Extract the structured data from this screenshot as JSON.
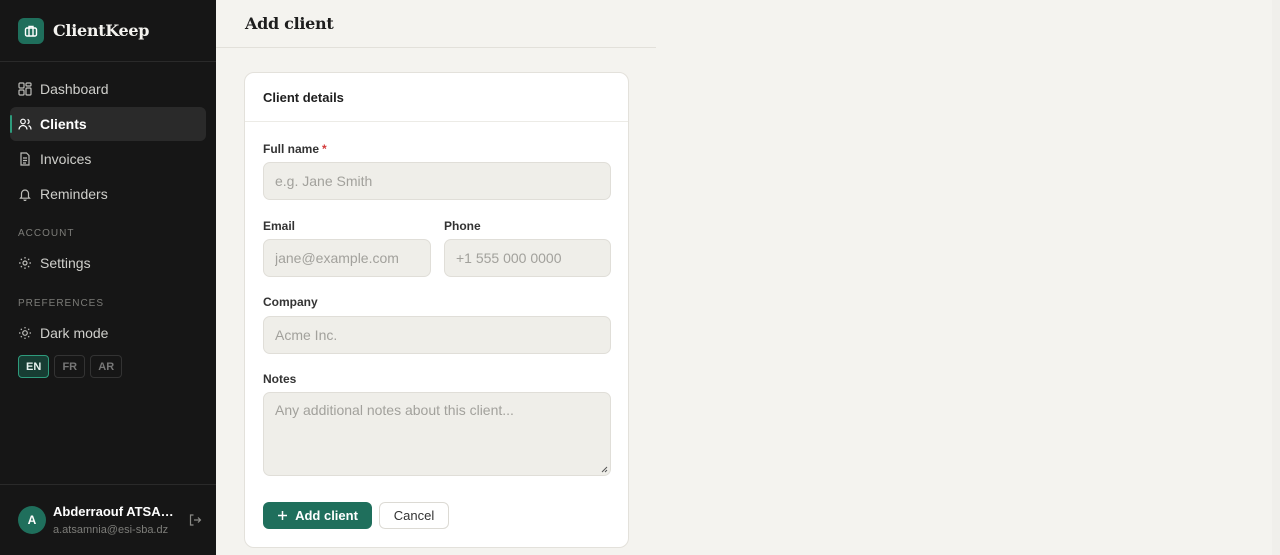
{
  "app": {
    "name": "ClientKeep"
  },
  "sidebar": {
    "nav": [
      {
        "label": "Dashboard",
        "icon": "grid-icon"
      },
      {
        "label": "Clients",
        "icon": "users-icon",
        "active": true
      },
      {
        "label": "Invoices",
        "icon": "document-icon"
      },
      {
        "label": "Reminders",
        "icon": "bell-icon"
      }
    ],
    "account_section": "ACCOUNT",
    "settings_label": "Settings",
    "preferences_section": "PREFERENCES",
    "dark_mode_label": "Dark mode",
    "languages": [
      "EN",
      "FR",
      "AR"
    ],
    "active_language": "EN"
  },
  "user": {
    "initial": "A",
    "name": "Abderraouf ATSAM...",
    "email": "a.atsamnia@esi-sba.dz"
  },
  "page": {
    "title": "Add client"
  },
  "form": {
    "card_title": "Client details",
    "full_name": {
      "label": "Full name",
      "required_mark": "*",
      "value": "",
      "placeholder": "e.g. Jane Smith"
    },
    "email": {
      "label": "Email",
      "value": "",
      "placeholder": "jane@example.com"
    },
    "phone": {
      "label": "Phone",
      "value": "",
      "placeholder": "+1 555 000 0000"
    },
    "company": {
      "label": "Company",
      "value": "",
      "placeholder": "Acme Inc."
    },
    "notes": {
      "label": "Notes",
      "value": "",
      "placeholder": "Any additional notes about this client..."
    },
    "submit_label": "Add client",
    "cancel_label": "Cancel"
  },
  "colors": {
    "accent": "#1f6f5c",
    "sidebar_bg": "#161616",
    "page_bg": "#f4f3ef",
    "required": "#d33a3a"
  }
}
